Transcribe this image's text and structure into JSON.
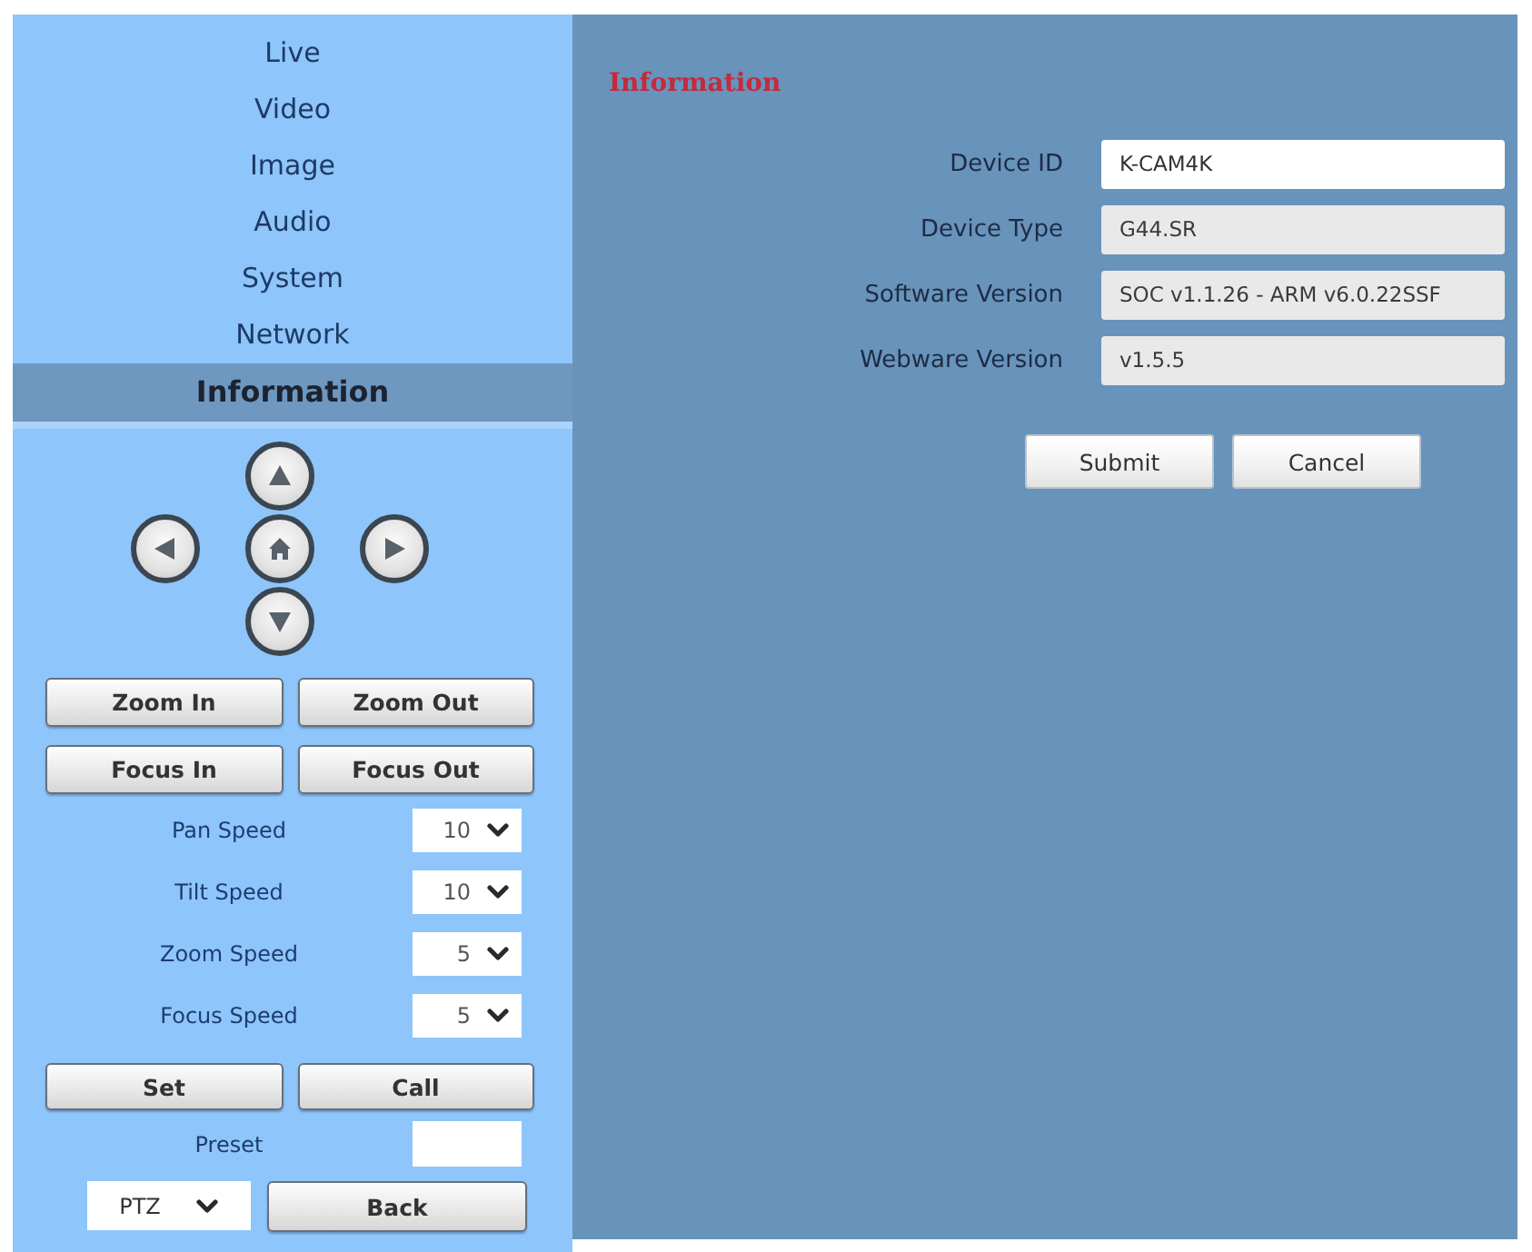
{
  "sidebar": {
    "nav": [
      {
        "label": "Live",
        "selected": false
      },
      {
        "label": "Video",
        "selected": false
      },
      {
        "label": "Image",
        "selected": false
      },
      {
        "label": "Audio",
        "selected": false
      },
      {
        "label": "System",
        "selected": false
      },
      {
        "label": "Network",
        "selected": false
      },
      {
        "label": "Information",
        "selected": true
      }
    ],
    "ptz": {
      "button_rows": [
        [
          "Zoom In",
          "Zoom Out"
        ],
        [
          "Focus In",
          "Focus Out"
        ]
      ],
      "speeds": [
        {
          "label": "Pan Speed",
          "value": "10"
        },
        {
          "label": "Tilt Speed",
          "value": "10"
        },
        {
          "label": "Zoom Speed",
          "value": "5"
        },
        {
          "label": "Focus Speed",
          "value": "5"
        }
      ],
      "preset_buttons": [
        "Set",
        "Call"
      ],
      "preset": {
        "label": "Preset"
      },
      "mode_select": {
        "value": "PTZ"
      },
      "back_button": {
        "label": "Back"
      }
    }
  },
  "main": {
    "title": "Information",
    "fields": [
      {
        "label": "Device ID",
        "value": "K-CAM4K",
        "disabled": false
      },
      {
        "label": "Device Type",
        "value": "G44.SR",
        "disabled": true
      },
      {
        "label": "Software Version",
        "value": "SOC v1.1.26 - ARM v6.0.22SSF",
        "disabled": true
      },
      {
        "label": "Webware Version",
        "value": "v1.5.5",
        "disabled": true
      }
    ],
    "buttons": [
      "Submit",
      "Cancel"
    ]
  }
}
